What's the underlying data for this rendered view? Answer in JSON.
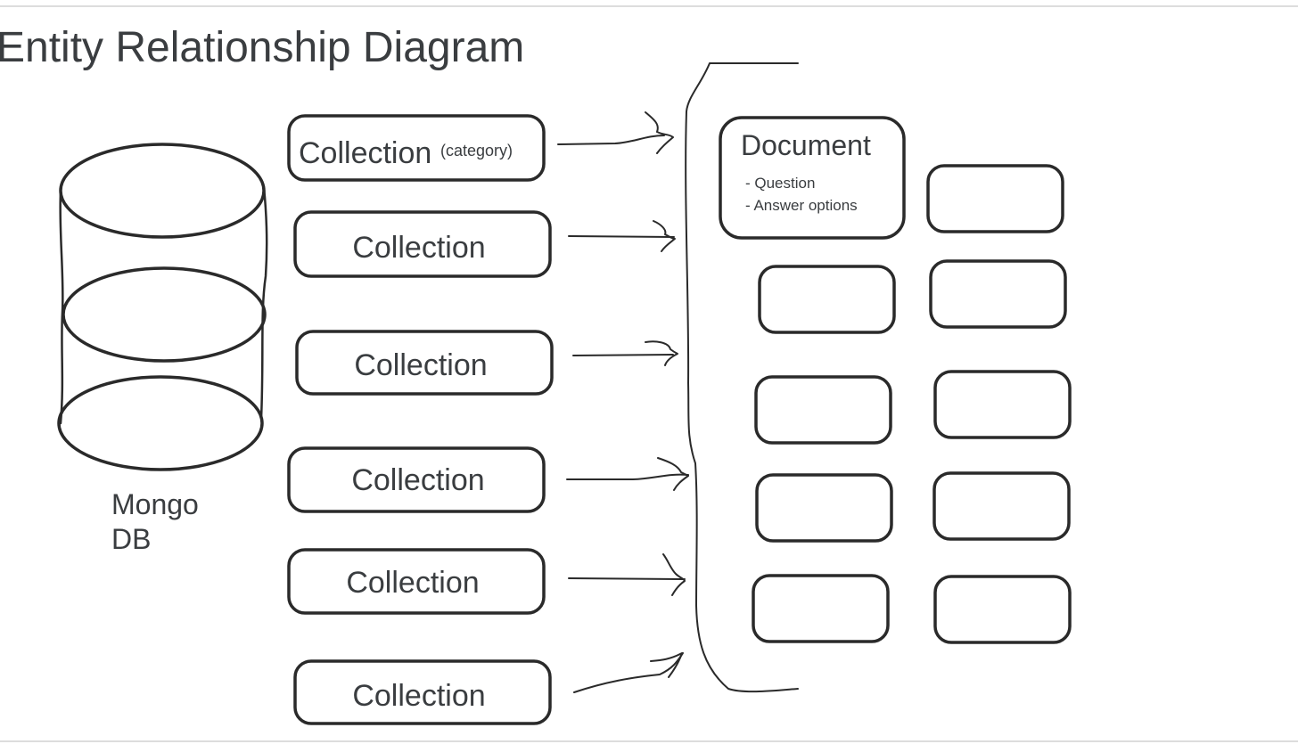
{
  "diagram": {
    "title": "Entity Relationship Diagram",
    "database": {
      "label_line1": "Mongo",
      "label_line2": "DB"
    },
    "collections": [
      {
        "label": "Collection",
        "note": "(category)"
      },
      {
        "label": "Collection"
      },
      {
        "label": "Collection"
      },
      {
        "label": "Collection"
      },
      {
        "label": "Collection"
      },
      {
        "label": "Collection"
      }
    ],
    "document": {
      "title": "Document",
      "fields": [
        "- Question",
        "- Answer options"
      ]
    },
    "colors": {
      "stroke": "#2a2a2a",
      "text": "#3a3d40",
      "frame_line": "#dddddd"
    }
  }
}
